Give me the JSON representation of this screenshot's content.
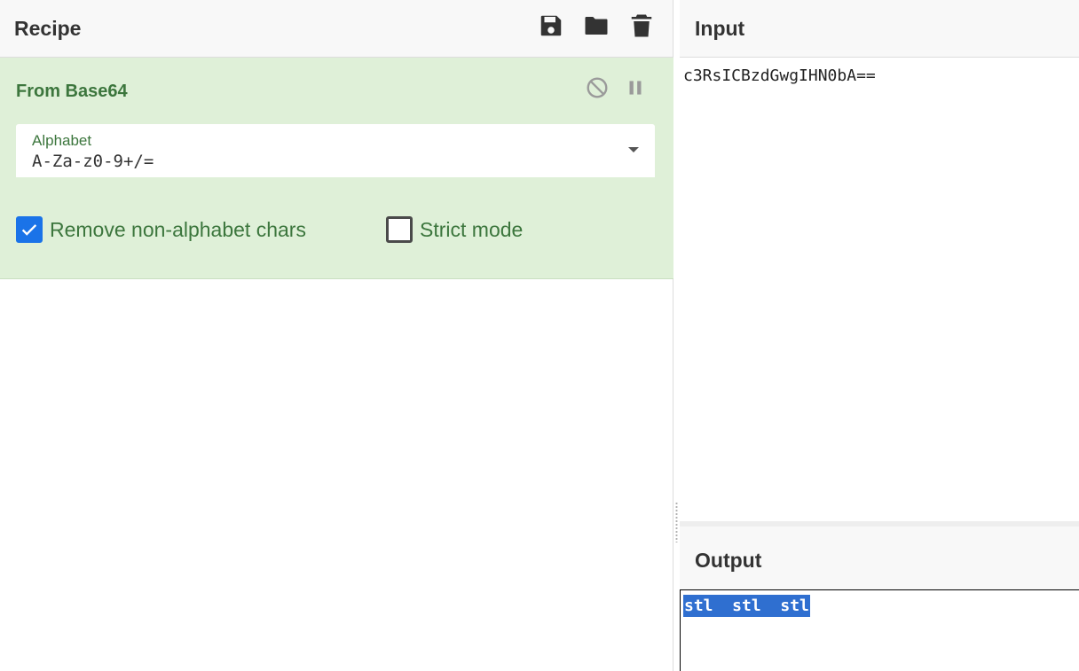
{
  "recipe": {
    "title": "Recipe",
    "toolbar": {
      "save_icon": "floppy-disk",
      "load_icon": "folder",
      "clear_icon": "trash-can"
    },
    "operation": {
      "name": "From Base64",
      "disable_icon": "circle-slash",
      "pause_icon": "pause",
      "alphabet_label": "Alphabet",
      "alphabet_value": "A-Za-z0-9+/=",
      "remove_non_alphabet_label": "Remove non-alphabet chars",
      "remove_non_alphabet_checked": true,
      "strict_mode_label": "Strict mode",
      "strict_mode_checked": false
    }
  },
  "input": {
    "title": "Input",
    "value": "c3RsICBzdGwgIHN0bA=="
  },
  "output": {
    "title": "Output",
    "value": "stl  stl  stl"
  },
  "colors": {
    "operation_bg": "#dff0d8",
    "operation_text": "#3c763d",
    "checkbox_checked": "#1a73e8",
    "selection": "#2f6fd0"
  }
}
